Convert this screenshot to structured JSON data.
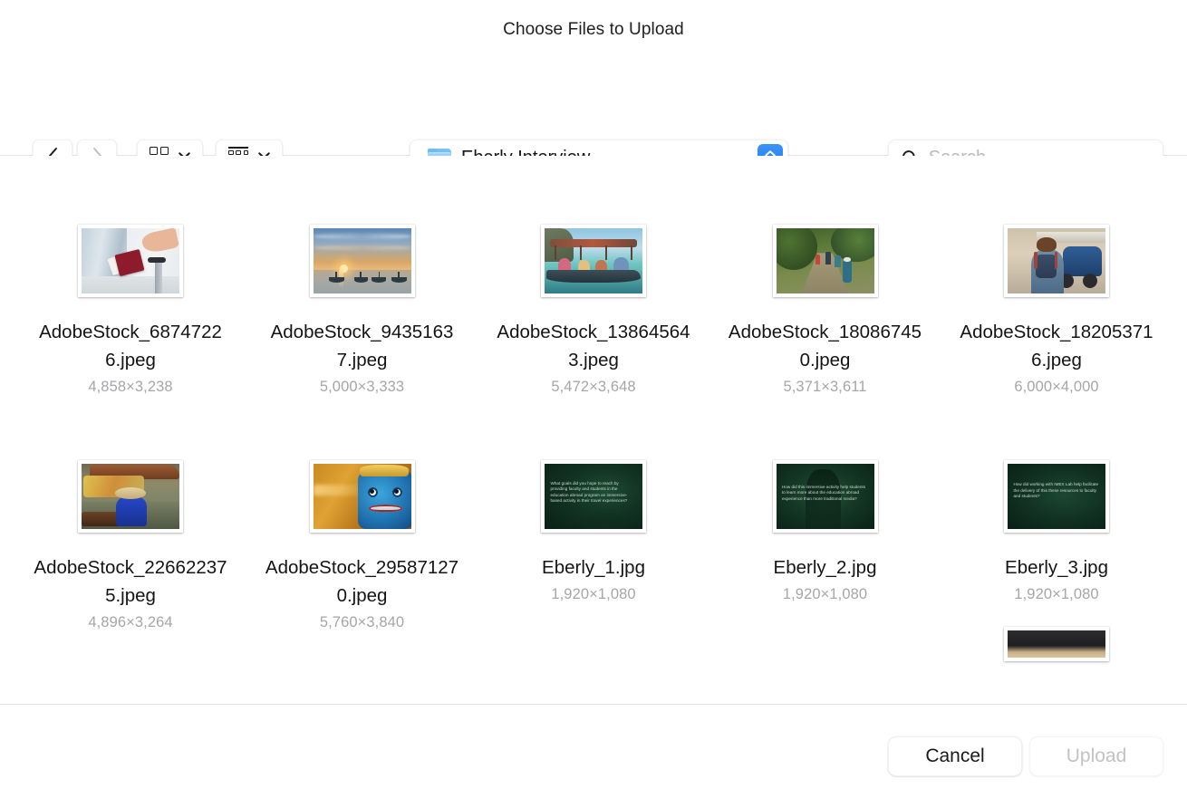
{
  "dialog": {
    "title": "Choose Files to Upload"
  },
  "toolbar": {
    "back_icon": "chevron-left-icon",
    "forward_icon": "chevron-right-icon",
    "view_mode_icon": "grid-view-icon",
    "view_mode_chevron": "chevron-down-icon",
    "group_icon": "group-list-icon",
    "group_chevron": "chevron-down-icon",
    "path_folder_icon": "folder-icon",
    "path_label": "Eberly Interview",
    "path_stepper_icon": "up-down-stepper-icon",
    "search": {
      "icon": "search-icon",
      "value": "",
      "placeholder": "Search"
    }
  },
  "files": [
    {
      "name": "AdobeStock_68747226.jpeg",
      "dimensions": "4,858×3,238",
      "art": "sc-airport"
    },
    {
      "name": "AdobeStock_94351637.jpeg",
      "dimensions": "5,000×3,333",
      "art": "sc-sunset"
    },
    {
      "name": "AdobeStock_138645643.jpeg",
      "dimensions": "5,472×3,648",
      "art": "sc-boat"
    },
    {
      "name": "AdobeStock_180867450.jpeg",
      "dimensions": "5,371×3,611",
      "art": "sc-jungle"
    },
    {
      "name": "AdobeStock_182053716.jpeg",
      "dimensions": "6,000×4,000",
      "art": "sc-street"
    },
    {
      "name": "AdobeStock_226622375.jpeg",
      "dimensions": "4,896×3,264",
      "art": "sc-market"
    },
    {
      "name": "AdobeStock_295871270.jpeg",
      "dimensions": "5,760×3,840",
      "art": "sc-mask"
    },
    {
      "name": "Eberly_1.jpg",
      "dimensions": "1,920×1,080",
      "art": "sc-eberly",
      "caption": "What goals did you hope to reach by providing faculty and students in the education abroad program an immersive-based activity in their travel experiences?"
    },
    {
      "name": "Eberly_2.jpg",
      "dimensions": "1,920×1,080",
      "art": "sc-eberly v2",
      "caption": "How did this immersive activity help students to learn more about the education abroad experience than more traditional media?"
    },
    {
      "name": "Eberly_3.jpg",
      "dimensions": "1,920×1,080",
      "art": "sc-eberly v3",
      "caption": "How did working with IMEX Lab help facilitate the delivery of this these resources to faculty and students?"
    }
  ],
  "footer": {
    "cancel_label": "Cancel",
    "upload_label": "Upload"
  },
  "colors": {
    "accent_blue": "#1a7cf0",
    "folder_blue": "#73bdef",
    "divider": "#e3e3e4",
    "dim_text": "#a6a6aa",
    "disabled_text": "#c2c2c6"
  }
}
